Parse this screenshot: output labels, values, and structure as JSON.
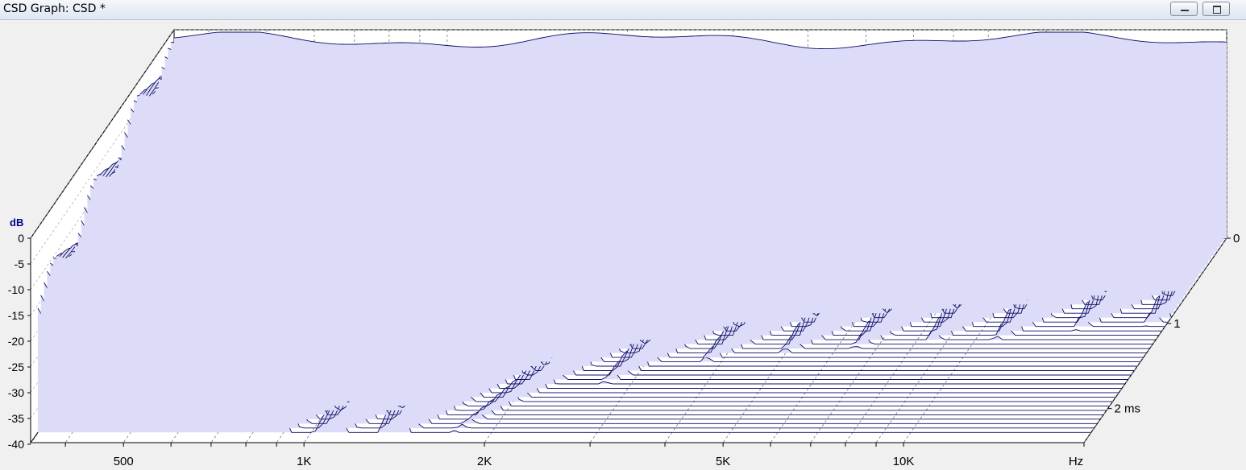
{
  "window": {
    "title": "CSD Graph: CSD *",
    "buttons": [
      "minimize",
      "maximize"
    ]
  },
  "chart_data": {
    "type": "area",
    "subtype": "cumulative spectral decay waterfall (3D)",
    "y_axis_title": "dB",
    "y_ticks": [
      "0",
      "-5",
      "-10",
      "-15",
      "-20",
      "-25",
      "-30",
      "-35",
      "-40"
    ],
    "ylim": [
      -40,
      0
    ],
    "x_ticks": [
      "500",
      "1K",
      "2K",
      "5K",
      "10K"
    ],
    "x_unit": "Hz",
    "x_scale": "log",
    "xlim": [
      350,
      20000
    ],
    "time_ticks": [
      "0",
      "1",
      "2 ms"
    ],
    "time_range_ms": [
      0,
      2.4
    ],
    "slices": 45,
    "grid": true,
    "colors": {
      "fill": "#dcdcf8",
      "line": "#0c0c64",
      "axis_text_accent": "#00008b"
    }
  }
}
